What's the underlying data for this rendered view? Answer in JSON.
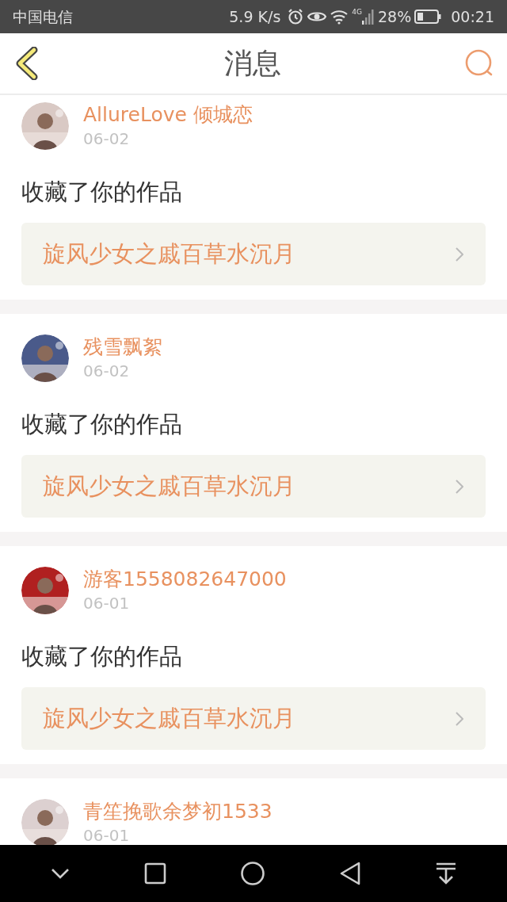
{
  "status_bar": {
    "carrier": "中国电信",
    "speed": "5.9 K/s",
    "network": "4G",
    "battery": "28%",
    "time": "00:21"
  },
  "header": {
    "title": "消息"
  },
  "messages": [
    {
      "user": "AllureLove 倾城恋",
      "date": "06-02",
      "action": "收藏了你的作品",
      "work": "旋风少女之戚百草水沉月"
    },
    {
      "user": "残雪飘絮",
      "date": "06-02",
      "action": "收藏了你的作品",
      "work": "旋风少女之戚百草水沉月"
    },
    {
      "user": "游客1558082647000",
      "date": "06-01",
      "action": "收藏了你的作品",
      "work": "旋风少女之戚百草水沉月"
    },
    {
      "user": "青笙挽歌余梦初1533",
      "date": "06-01"
    }
  ]
}
